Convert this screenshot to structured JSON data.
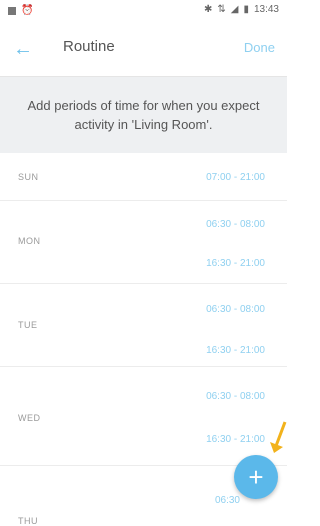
{
  "status_bar": {
    "time": "13:43",
    "icons": [
      "notification-icon",
      "alarm-icon",
      "bluetooth-icon",
      "data-icon",
      "signal-icon",
      "battery-icon"
    ]
  },
  "app_bar": {
    "back_icon": "arrow-left-icon",
    "title": "Routine",
    "done_label": "Done"
  },
  "banner": {
    "text": "Add periods of time for when you expect activity in 'Living Room'."
  },
  "routine": {
    "days": [
      {
        "label": "SUN",
        "slots": [
          "07:00 - 21:00"
        ]
      },
      {
        "label": "MON",
        "slots": [
          "06:30 - 08:00",
          "16:30 - 21:00"
        ]
      },
      {
        "label": "TUE",
        "slots": [
          "06:30 - 08:00",
          "16:30 - 21:00"
        ]
      },
      {
        "label": "WED",
        "slots": [
          "06:30 - 08:00",
          "16:30 - 21:00"
        ]
      },
      {
        "label": "THU",
        "slots": [
          "06:30"
        ]
      }
    ]
  },
  "fab": {
    "icon": "plus-icon",
    "label": "+"
  },
  "colors": {
    "accent": "#5bb8ea",
    "link": "#8fd0f0",
    "banner_bg": "#eef0f2",
    "annotation": "#f2b21b"
  }
}
